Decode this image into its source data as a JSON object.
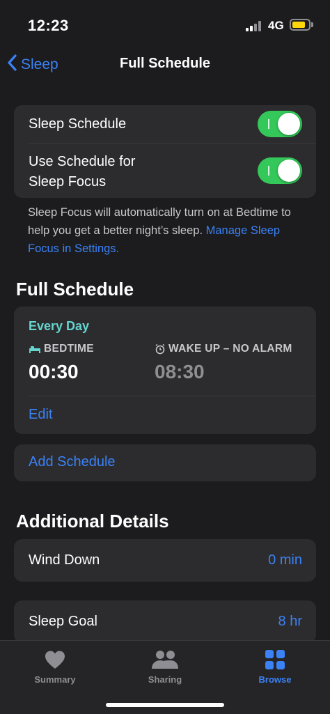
{
  "status_bar": {
    "time": "12:23",
    "network": "4G",
    "battery_level": 0.8,
    "battery_color": "#ffd60a"
  },
  "nav": {
    "back_label": "Sleep",
    "title": "Full Schedule"
  },
  "settings": {
    "sleep_schedule_label": "Sleep Schedule",
    "sleep_schedule_on": true,
    "use_schedule_line1": "Use Schedule for",
    "use_schedule_line2": "Sleep Focus",
    "use_schedule_on": true,
    "footnote_text": "Sleep Focus will automatically turn on at Bedtime to help you get a better night’s sleep.",
    "footnote_link": "Manage Sleep Focus in Settings."
  },
  "full_schedule": {
    "section_title": "Full Schedule",
    "days": "Every Day",
    "bedtime_label": "BEDTIME",
    "bedtime": "00:30",
    "wakeup_label": "WAKE UP – NO ALARM",
    "wakeup": "08:30",
    "edit_label": "Edit",
    "add_schedule_label": "Add Schedule"
  },
  "additional": {
    "section_title": "Additional Details",
    "wind_down_label": "Wind Down",
    "wind_down_value": "0 min",
    "sleep_goal_label": "Sleep Goal",
    "sleep_goal_value": "8 hr"
  },
  "tabs": [
    {
      "label": "Summary",
      "icon": "heart-icon",
      "active": false
    },
    {
      "label": "Sharing",
      "icon": "people-icon",
      "active": false
    },
    {
      "label": "Browse",
      "icon": "grid-icon",
      "active": true
    }
  ],
  "colors": {
    "accent": "#3b82f6",
    "toggle_on": "#34c759",
    "every_day": "#66d4cf",
    "background": "#1c1c1e",
    "card": "#2c2c2e"
  }
}
